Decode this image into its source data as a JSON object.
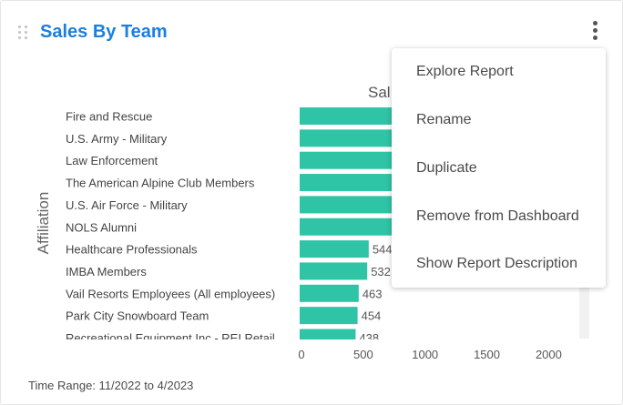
{
  "card": {
    "title": "Sales By Team",
    "time_range": "Time Range: 11/2022 to 4/2023"
  },
  "icons": {
    "drag": "drag-handle-icon",
    "more": "more-vertical-icon"
  },
  "colors": {
    "title": "#1a7fe0",
    "bar": "#2ec4a5",
    "text": "#4a4a4a"
  },
  "menu": {
    "items": [
      {
        "label": "Explore Report"
      },
      {
        "label": "Rename"
      },
      {
        "label": "Duplicate"
      },
      {
        "label": "Remove from Dashboard"
      },
      {
        "label": "Show Report Description"
      }
    ]
  },
  "chart_data": {
    "type": "bar",
    "orientation": "horizontal",
    "title": "Sal",
    "ylabel": "Affiliation",
    "xlabel": "",
    "xlim": [
      0,
      2200
    ],
    "x_ticks": [
      "0",
      "500",
      "1000",
      "1500",
      "2000"
    ],
    "categories": [
      "Fire and Rescue",
      "U.S. Army - Military",
      "Law Enforcement",
      "The American Alpine Club Members",
      "U.S. Air Force - Military",
      "NOLS Alumni",
      "Healthcare Professionals",
      "IMBA Members",
      "Vail Resorts Employees (All employees)",
      "Park City Snowboard Team",
      "Recreational Equipment Inc - REI Retail"
    ],
    "values": [
      800,
      790,
      780,
      770,
      760,
      750,
      544,
      532,
      463,
      454,
      438
    ],
    "data_labels": [
      "",
      "",
      "",
      "",
      "",
      "",
      "544",
      "532",
      "463",
      "454",
      "438"
    ]
  }
}
